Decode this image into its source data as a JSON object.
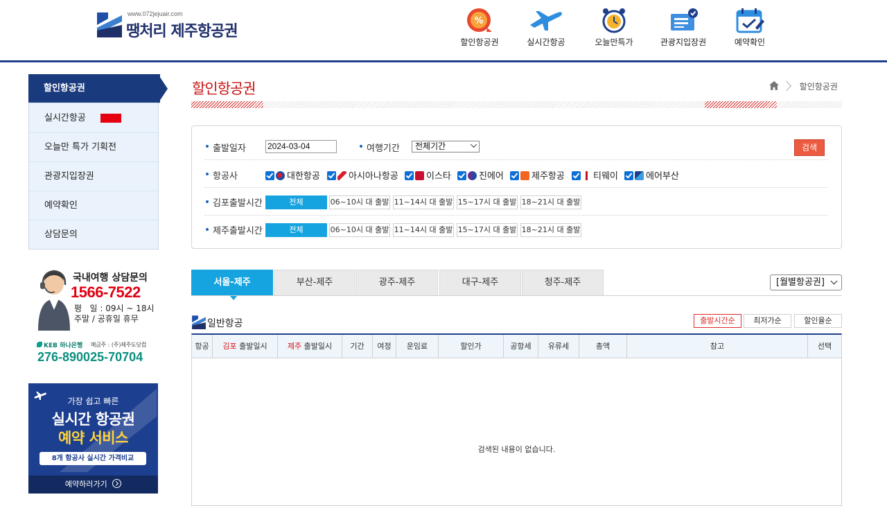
{
  "header": {
    "logo_url": "www.072jejuair.com",
    "logo_name": "땡처리 제주항공권",
    "nav": [
      {
        "label": "할인항공권",
        "icon": "discount-badge-icon"
      },
      {
        "label": "실시간항공",
        "icon": "airplane-icon"
      },
      {
        "label": "오늘만특가",
        "icon": "alarm-clock-icon"
      },
      {
        "label": "관광지입장권",
        "icon": "ticket-icon"
      },
      {
        "label": "예약확인",
        "icon": "calendar-check-icon"
      }
    ]
  },
  "sidebar": {
    "items": [
      {
        "label": "할인항공권"
      },
      {
        "label": "실시간항공"
      },
      {
        "label": "오늘만 특가 기획전"
      },
      {
        "label": "관광지입장권"
      },
      {
        "label": "예약확인"
      },
      {
        "label": "상담문의"
      }
    ]
  },
  "contact": {
    "title": "국내여행 상담문의",
    "phone": "1566-7522",
    "hours": "평   일 : 09시 ~ 18시",
    "holiday": "주말 / 공휴일 휴무",
    "bank": "KEB 하나은행",
    "holder": "예금주 : (주)제주도닷컴",
    "account": "276-890025-70704"
  },
  "banner": {
    "line1": "가장 쉽고 빠른",
    "line2": "실시간 항공권",
    "line3": "예약 서비스",
    "line4": "8개 항공사 실시간 가격비교",
    "cta": "예약하러가기"
  },
  "main": {
    "title": "할인항공권",
    "breadcrumb": "할인항공권"
  },
  "search": {
    "date_label": "출발일자",
    "date_value": "2024-03-04",
    "period_label": "여행기간",
    "period_value": "전체기간",
    "search_button": "검색",
    "airline_label": "항공사",
    "airlines": [
      {
        "name": "대한항공",
        "color": "#1b4ea3"
      },
      {
        "name": "아시아나항공",
        "color": "#d81e2c"
      },
      {
        "name": "이스타",
        "color": "#c8102e"
      },
      {
        "name": "진에어",
        "color": "#6b2c91"
      },
      {
        "name": "제주항공",
        "color": "#f26522"
      },
      {
        "name": "티웨이",
        "color": "#c8102e"
      },
      {
        "name": "에어부산",
        "color": "#1f3f8a"
      }
    ],
    "gimpo_label": "김포출발시간",
    "jeju_label": "제주출발시간",
    "time_options": [
      "전체",
      "06~10시 대 출발",
      "11~14시 대 출발",
      "15~17시 대 출발",
      "18~21시 대 출발"
    ]
  },
  "routes": [
    "서울-제주",
    "부산-제주",
    "광주-제주",
    "대구-제주",
    "청주-제주"
  ],
  "month_select": "[월별항공권]",
  "list": {
    "title": "일반항공",
    "sorts": [
      "출발시간순",
      "최저가순",
      "할인율순"
    ],
    "columns": {
      "airline": "항공",
      "gimpo": "김포",
      "gimpo_suffix": " 출발일시",
      "jeju": "제주",
      "jeju_suffix": " 출발일시",
      "period": "기간",
      "seats": "여정",
      "fare": "운임료",
      "discount": "할인가",
      "airport_tax": "공항세",
      "fuel_tax": "유류세",
      "total": "총액",
      "note": "참고",
      "select": "선택"
    },
    "empty": "검색된 내용이 없습니다."
  }
}
